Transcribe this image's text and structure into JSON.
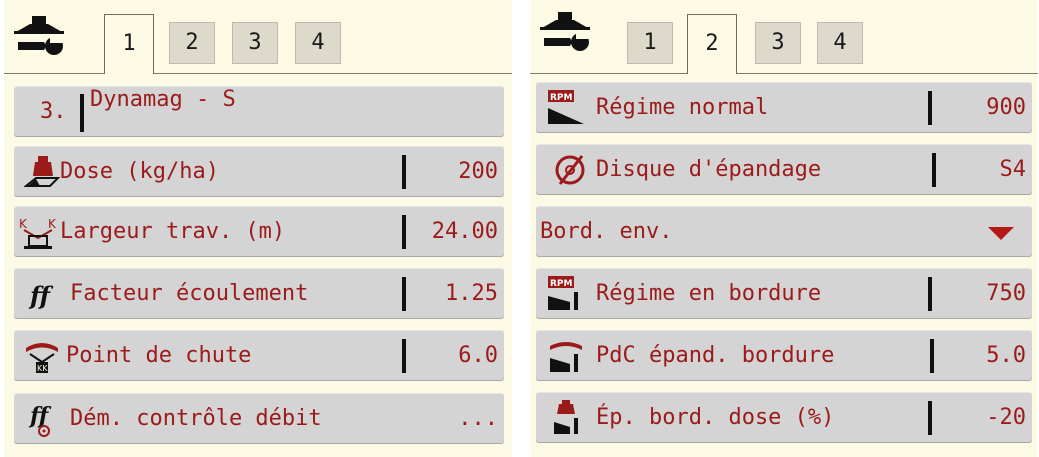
{
  "left_panel": {
    "tabs": [
      "1",
      "2",
      "3",
      "4"
    ],
    "active_tab": "1",
    "rows": [
      {
        "prefix": "3.",
        "label": "Dynamag - S"
      },
      {
        "label": "Dose (kg/ha)",
        "value": "200",
        "icon": "dose-weight-icon"
      },
      {
        "label": "Largeur trav. (m)",
        "value": "24.00",
        "icon": "working-width-icon"
      },
      {
        "label": "Facteur écoulement",
        "value": "1.25",
        "icon": "flow-factor-icon"
      },
      {
        "label": "Point de chute",
        "value": "6.0",
        "icon": "drop-point-icon"
      },
      {
        "label": "Dém. contrôle débit",
        "value": "...",
        "icon": "flow-control-icon"
      }
    ]
  },
  "right_panel": {
    "tabs": [
      "1",
      "2",
      "3",
      "4"
    ],
    "active_tab": "2",
    "rows": [
      {
        "label": "Régime normal",
        "value": "900",
        "icon": "rpm-normal-icon",
        "icon_text": "RPM"
      },
      {
        "label": "Disque d'épandage",
        "value": "S4",
        "icon": "spreading-disc-icon"
      },
      {
        "label": "Bord. env.",
        "icon": "dropdown-arrow-icon"
      },
      {
        "label": "Régime en bordure",
        "value": "750",
        "icon": "rpm-border-icon",
        "icon_text": "RPM"
      },
      {
        "label": "PdC épand. bordure",
        "value": "5.0",
        "icon": "border-drop-point-icon"
      },
      {
        "label": "Ép. bord. dose (%)",
        "value": "-20",
        "icon": "border-dose-icon"
      }
    ]
  },
  "colors": {
    "text_accent": "#9b1a1a",
    "panel_bg": "#fcf9e4",
    "row_bg": "#d4d4d4",
    "arrow": "#b51818"
  }
}
